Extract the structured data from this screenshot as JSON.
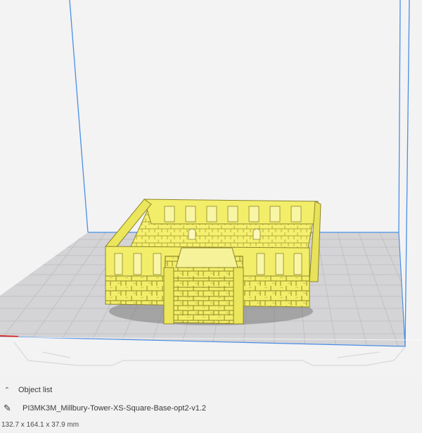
{
  "object_list": {
    "header_label": "Object list",
    "toggle_icon": "chevron-up-icon",
    "items": [
      {
        "edit_icon": "pencil-icon",
        "name": "PI3MK3M_Millbury-Tower-XS-Square-Base-opt2-v1.2"
      }
    ],
    "dimensions": "132.7 x 164.1 x 37.9 mm"
  },
  "colors": {
    "model": "#f3ee6a",
    "build_volume": "#4a8ee6",
    "build_plate": "#d2d2d4",
    "grid": "#bdbdbd",
    "x_axis": "#d9302a"
  }
}
